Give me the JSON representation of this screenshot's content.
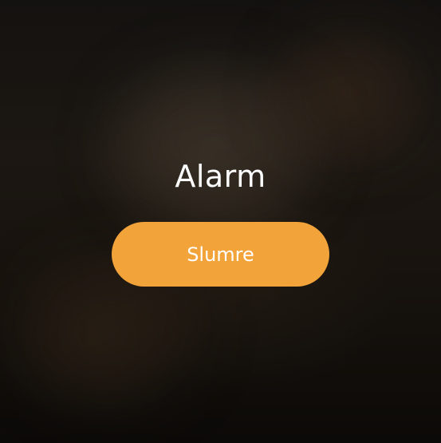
{
  "alarm": {
    "title": "Alarm",
    "snooze_label": "Slumre",
    "snooze_color": "#f2a33a"
  }
}
